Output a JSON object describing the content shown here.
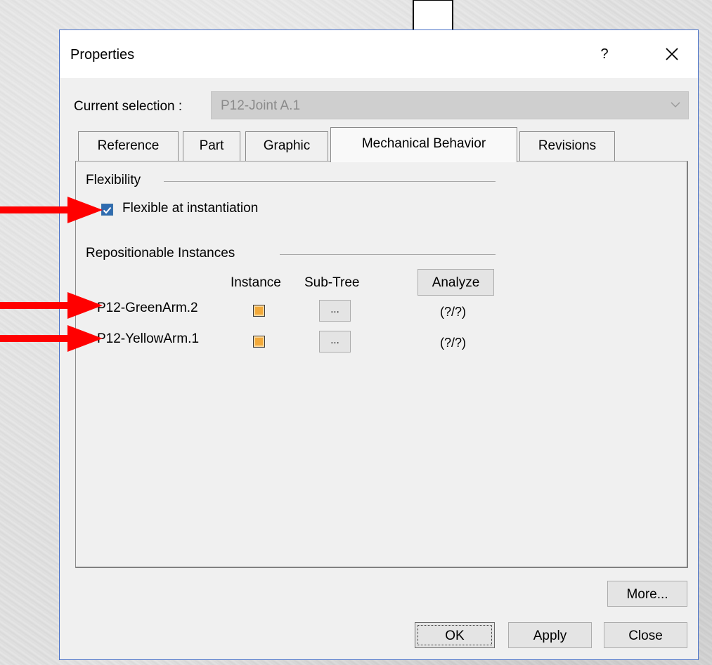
{
  "dialog": {
    "title": "Properties",
    "help_label": "?",
    "close_icon": "close-icon"
  },
  "selection": {
    "label": "Current selection :",
    "value": "P12-Joint A.1"
  },
  "tabs": [
    {
      "label": "Reference",
      "active": false
    },
    {
      "label": "Part",
      "active": false
    },
    {
      "label": "Graphic",
      "active": false
    },
    {
      "label": "Mechanical Behavior",
      "active": true
    },
    {
      "label": "Revisions",
      "active": false
    }
  ],
  "flexibility": {
    "group_label": "Flexibility",
    "checkbox_label": "Flexible at instantiation",
    "checked": true
  },
  "repositionable": {
    "group_label": "Repositionable Instances",
    "col_instance": "Instance",
    "col_subtree": "Sub-Tree",
    "analyze_label": "Analyze",
    "rows": [
      {
        "name": "P12-GreenArm.2",
        "subtree_button": "...",
        "status": "(?/?)"
      },
      {
        "name": "P12-YellowArm.1",
        "subtree_button": "...",
        "status": "(?/?)"
      }
    ]
  },
  "buttons": {
    "more": "More...",
    "ok": "OK",
    "apply": "Apply",
    "close": "Close"
  },
  "colors": {
    "annotation_arrow": "#ff0000",
    "dialog_border": "#4a72c8",
    "checkbox_fill": "#2f6cb0"
  }
}
